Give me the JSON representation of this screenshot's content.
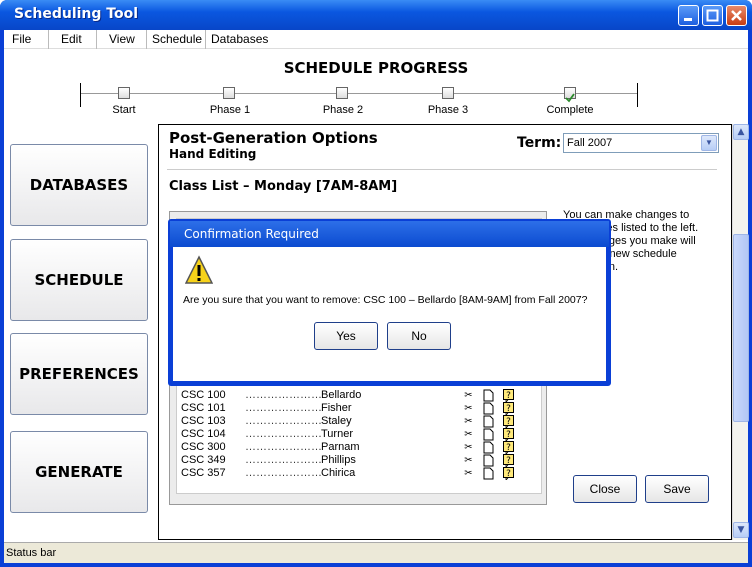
{
  "window": {
    "title": "Scheduling Tool"
  },
  "menu": [
    "File",
    "Edit",
    "View",
    "Schedule",
    "Databases"
  ],
  "progress": {
    "title": "SCHEDULE PROGRESS",
    "steps": [
      {
        "label": "Start",
        "checked": false
      },
      {
        "label": "Phase 1",
        "checked": false
      },
      {
        "label": "Phase 2",
        "checked": false
      },
      {
        "label": "Phase 3",
        "checked": false
      },
      {
        "label": "Complete",
        "checked": true
      }
    ]
  },
  "nav": [
    "DATABASES",
    "SCHEDULE",
    "PREFERENCES",
    "GENERATE"
  ],
  "main": {
    "title": "Post-Generation Options",
    "subtitle": "Hand Editing",
    "term_label": "Term:",
    "term_value": "Fall 2007",
    "class_list_title": "Class List – Monday [7AM-8AM]",
    "note": "You can make changes to the classes listed to the left. Any changes you make will require a new schedule generation.",
    "rows": [
      {
        "code": "CSC 100",
        "dots": "…………………",
        "instructor": "Bellardo"
      },
      {
        "code": "CSC 101",
        "dots": "…………………",
        "instructor": "Fisher"
      },
      {
        "code": "CSC 103",
        "dots": "…………………",
        "instructor": "Staley"
      },
      {
        "code": "CSC 104",
        "dots": "…………………",
        "instructor": "Turner"
      },
      {
        "code": "CSC 300",
        "dots": "…………………",
        "instructor": "Parnam"
      },
      {
        "code": "CSC 349",
        "dots": "…………………",
        "instructor": "Phillips"
      },
      {
        "code": "CSC 357",
        "dots": "…………………",
        "instructor": "Chirica"
      }
    ],
    "close_label": "Close",
    "save_label": "Save"
  },
  "dialog": {
    "title": "Confirmation Required",
    "message": "Are you sure that you want to remove: CSC 100 – Bellardo [8AM-9AM] from Fall 2007?",
    "yes_label": "Yes",
    "no_label": "No"
  },
  "status": {
    "text": "Status bar"
  },
  "icons": [
    "scissors-icon",
    "document-icon",
    "question-icon",
    "warning-icon"
  ]
}
